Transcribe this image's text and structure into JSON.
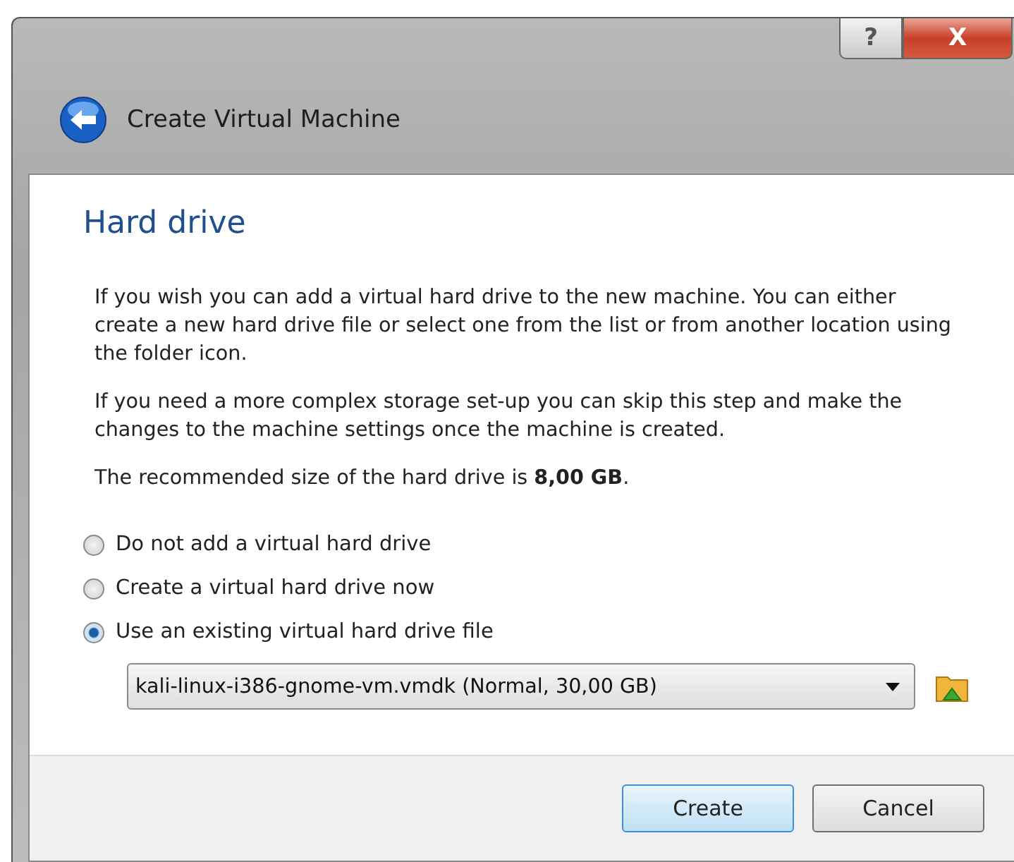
{
  "window": {
    "title": "Create Virtual Machine",
    "help_button": "?",
    "close_button": "X"
  },
  "page": {
    "heading": "Hard drive",
    "paragraphs": [
      "If you wish you can add a virtual hard drive to the new machine. You can either create a new hard drive file or select one from the list or from another location using the folder icon.",
      "If you need a more complex storage set-up you can skip this step and make the changes to the machine settings once the machine is created.",
      "The recommended size of the hard drive is **8,00 GB**."
    ]
  },
  "options": [
    {
      "label": "Do not add a virtual hard drive",
      "selected": false
    },
    {
      "label": "Create a virtual hard drive now",
      "selected": false
    },
    {
      "label": "Use an existing virtual hard drive file",
      "selected": true
    }
  ],
  "file_select": {
    "value": "kali-linux-i386-gnome-vm.vmdk (Normal, 30,00 GB)"
  },
  "buttons": [
    {
      "label": "Create",
      "default": true
    },
    {
      "label": "Cancel",
      "default": false
    }
  ]
}
